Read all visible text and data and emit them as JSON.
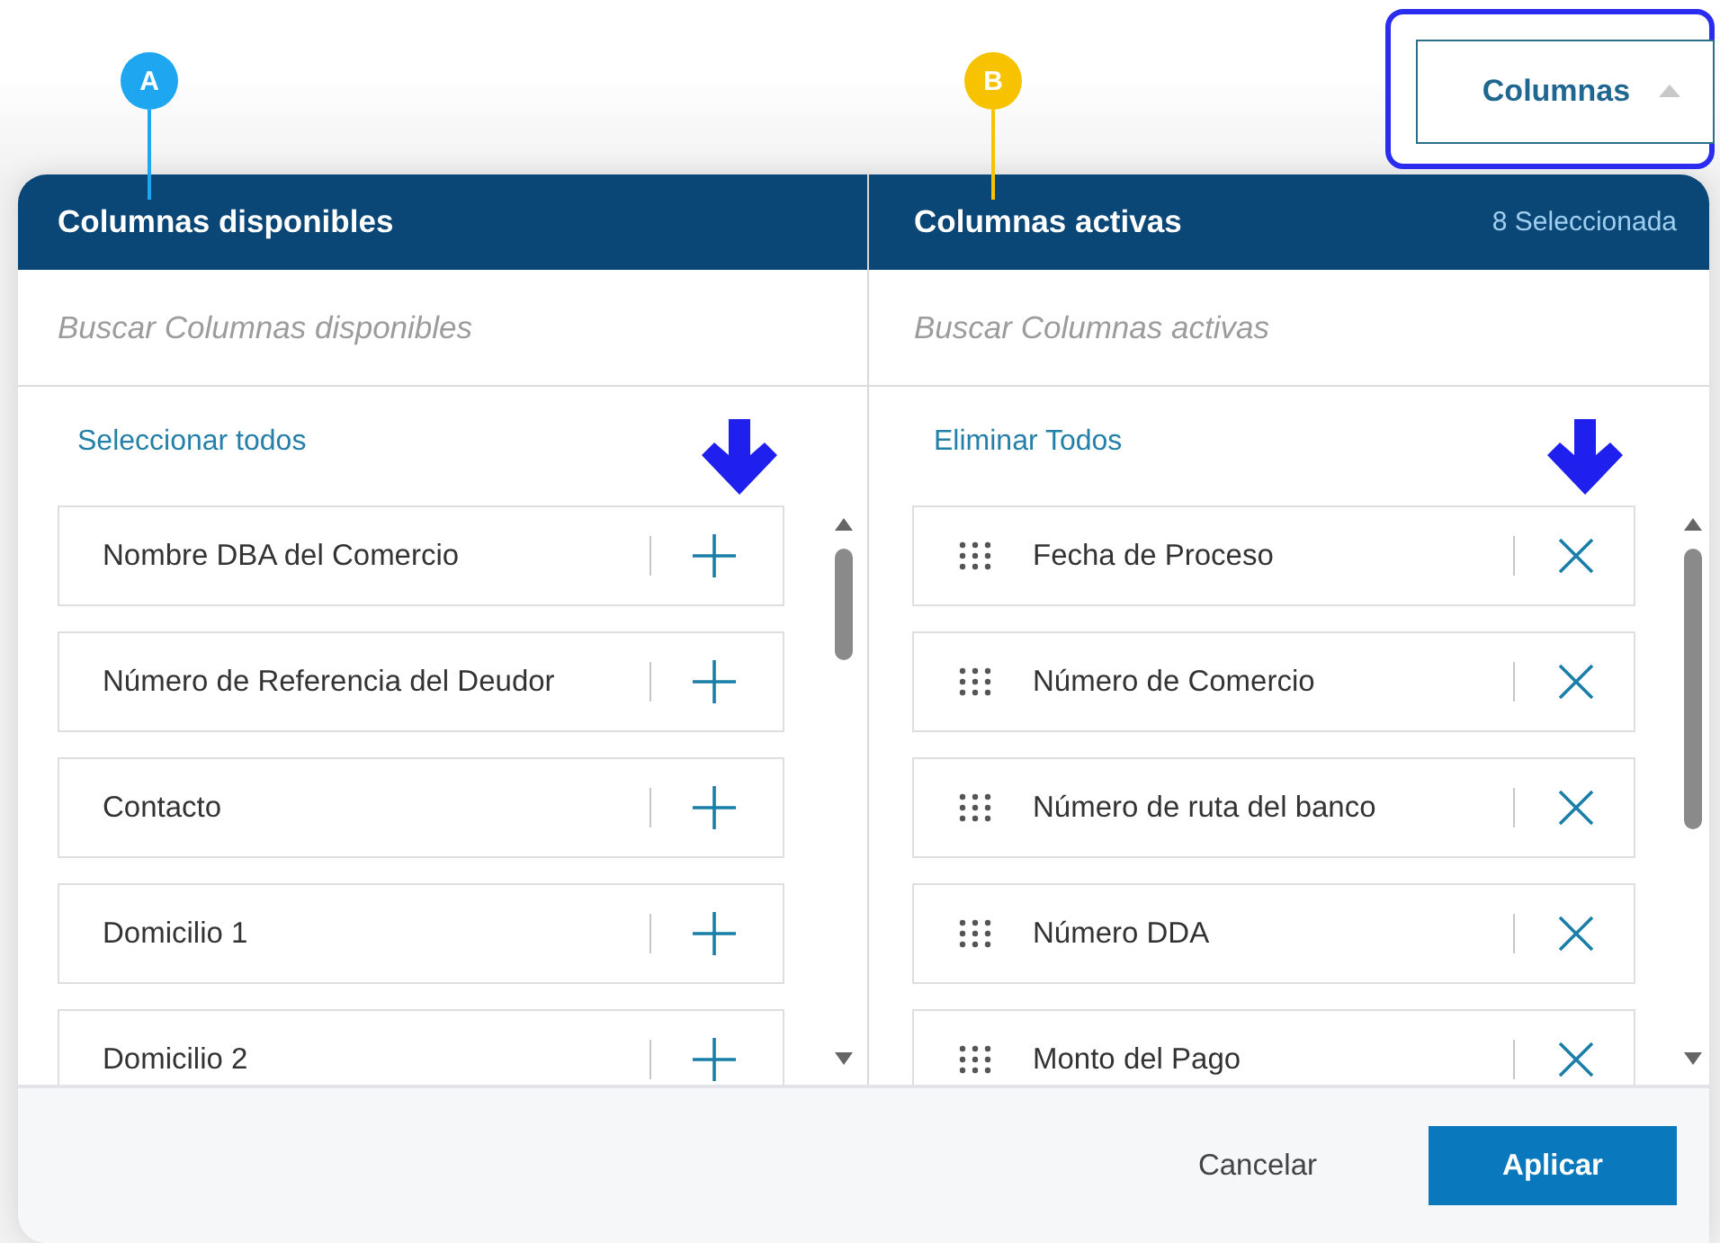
{
  "toggle_button": {
    "label": "Columnas",
    "expanded": true,
    "highlighted": true
  },
  "panels": [
    {
      "marker": {
        "label": "A",
        "color": "#1ea7f0"
      },
      "title": "Columnas disponibles",
      "search": {
        "placeholder": "Buscar Columnas disponibles"
      },
      "bulk_action": "Seleccionar todos",
      "pointer_arrow": true,
      "items": [
        {
          "label": "Nombre DBA del Comercio",
          "kind": "add"
        },
        {
          "label": "Número de Referencia del Deudor",
          "kind": "add"
        },
        {
          "label": "Contacto",
          "kind": "add"
        },
        {
          "label": "Domicilio 1",
          "kind": "add"
        },
        {
          "label": "Domicilio 2",
          "kind": "add"
        }
      ]
    },
    {
      "marker": {
        "label": "B",
        "color": "#f7c200"
      },
      "title": "Columnas activas",
      "count": "8 Seleccionada",
      "search": {
        "placeholder": "Buscar Columnas activas"
      },
      "bulk_action": "Eliminar Todos",
      "pointer_arrow": true,
      "items": [
        {
          "label": "Fecha de Proceso",
          "kind": "remove"
        },
        {
          "label": "Número de Comercio",
          "kind": "remove"
        },
        {
          "label": "Número de ruta del banco",
          "kind": "remove"
        },
        {
          "label": "Número DDA",
          "kind": "remove"
        },
        {
          "label": "Monto del Pago",
          "kind": "remove"
        }
      ]
    }
  ],
  "buttons": [
    {
      "label": "Cancelar",
      "kind": "secondary"
    },
    {
      "label": "Aplicar",
      "kind": "primary"
    }
  ]
}
